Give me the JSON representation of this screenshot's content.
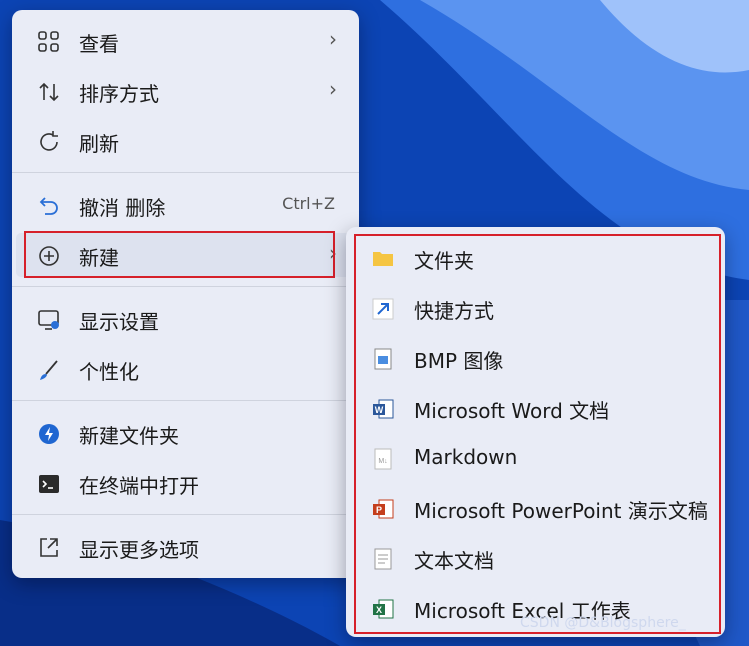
{
  "menu": {
    "view": "查看",
    "sort": "排序方式",
    "refresh": "刷新",
    "undo": "撤消 删除",
    "undo_shortcut": "Ctrl+Z",
    "new": "新建",
    "display": "显示设置",
    "personalize": "个性化",
    "new_folder": "新建文件夹",
    "terminal": "在终端中打开",
    "more": "显示更多选项"
  },
  "submenu": {
    "items": [
      "文件夹",
      "快捷方式",
      "BMP 图像",
      "Microsoft Word 文档",
      "Markdown",
      "Microsoft PowerPoint 演示文稿",
      "文本文档",
      "Microsoft Excel 工作表"
    ]
  },
  "watermark": "CSDN @D&Blogsphere_",
  "colors": {
    "highlight": "#d6202a",
    "menu_bg": "#e9ecf6"
  }
}
